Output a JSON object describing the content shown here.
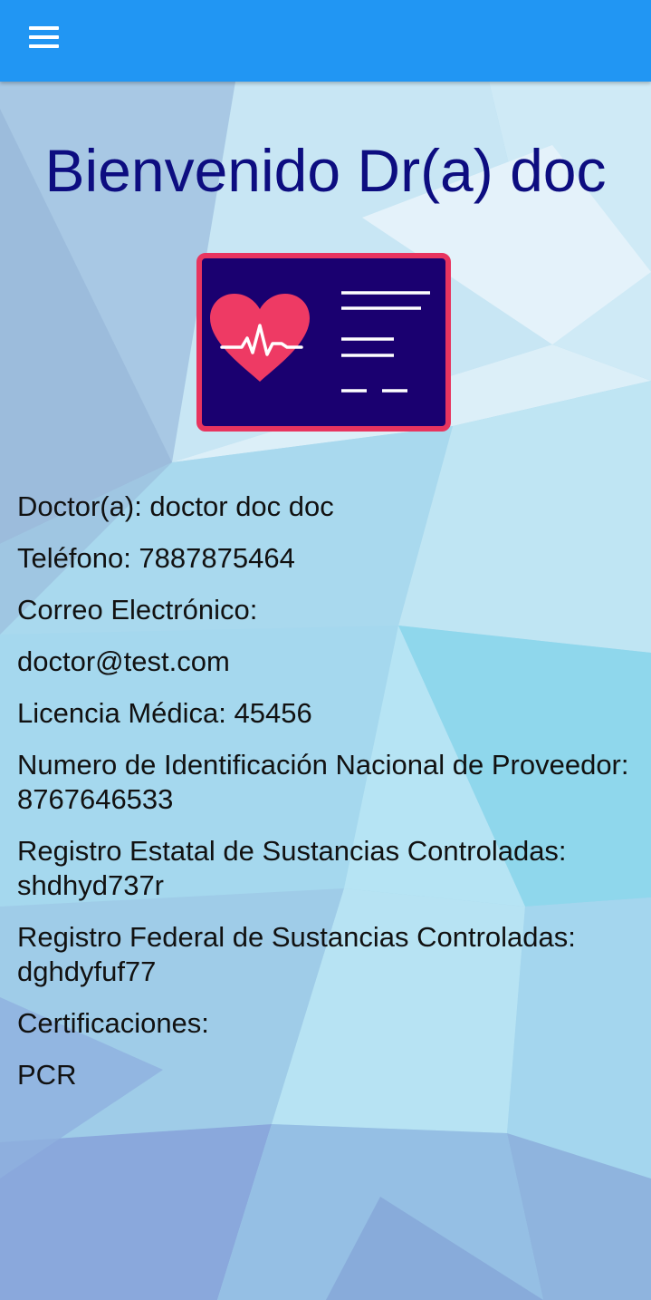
{
  "header": {
    "menu_icon": "hamburger-menu-icon",
    "background_color": "#2196f3"
  },
  "welcome": {
    "title": "Bienvenido Dr(a) doc",
    "title_color": "#0d0d80"
  },
  "illustration": {
    "icon": "medical-card-heart-icon",
    "card_color": "#1a0070",
    "border_color": "#e8345f",
    "heart_color": "#ee3a64"
  },
  "doctor_info": {
    "doctor": "Doctor(a): doctor  doc doc",
    "phone": "Teléfono: 7887875464",
    "email_label": "Correo Electrónico:",
    "email": "doctor@test.com",
    "license": "Licencia Médica: 45456",
    "npi": "Numero de Identificación Nacional de Proveedor: 8767646533",
    "state_registry": "Registro Estatal de Sustancias Controladas: shdhyd737r",
    "federal_registry": "Registro Federal de Sustancias Controladas: dghdyfuf77",
    "certifications_label": "Certificaciones:",
    "certification_1": "PCR"
  }
}
